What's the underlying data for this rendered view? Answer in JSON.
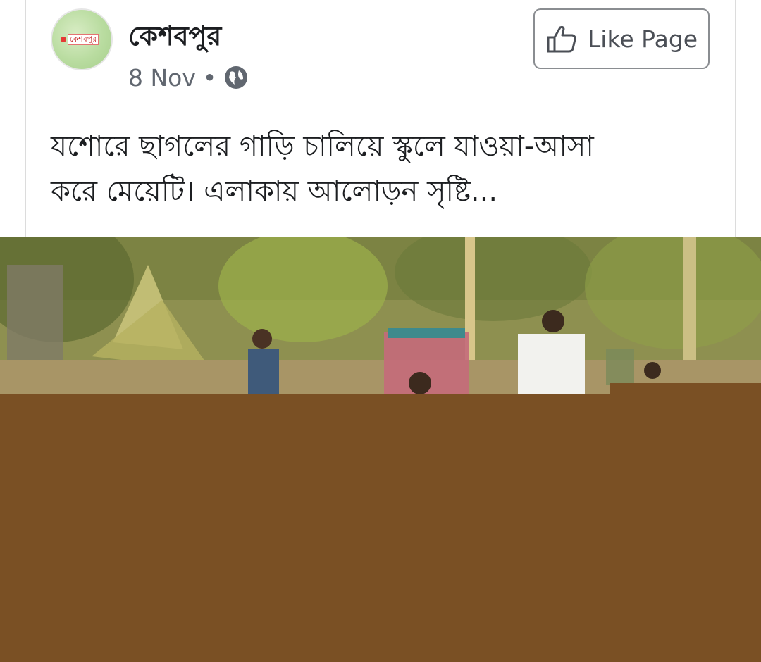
{
  "post": {
    "page_name": "কেশবপুর",
    "avatar_text": "কেশবপুর",
    "date": "8 Nov",
    "separator": "•",
    "privacy_icon": "globe-icon",
    "like_button_label": "Like Page",
    "like_icon": "thumbs-up-icon",
    "text_line1": "যশোরে ছাগলের গাড়ি চালিয়ে স্কুলে যাওয়া-আসা",
    "text_line2": "করে মেয়েটি। এলাকায় আলোড়ন সৃষ্টি..."
  },
  "colors": {
    "text_primary": "#1c1e21",
    "text_secondary": "#616770",
    "button_border": "#8a8d91",
    "brown_overlay": "#7a5024"
  }
}
